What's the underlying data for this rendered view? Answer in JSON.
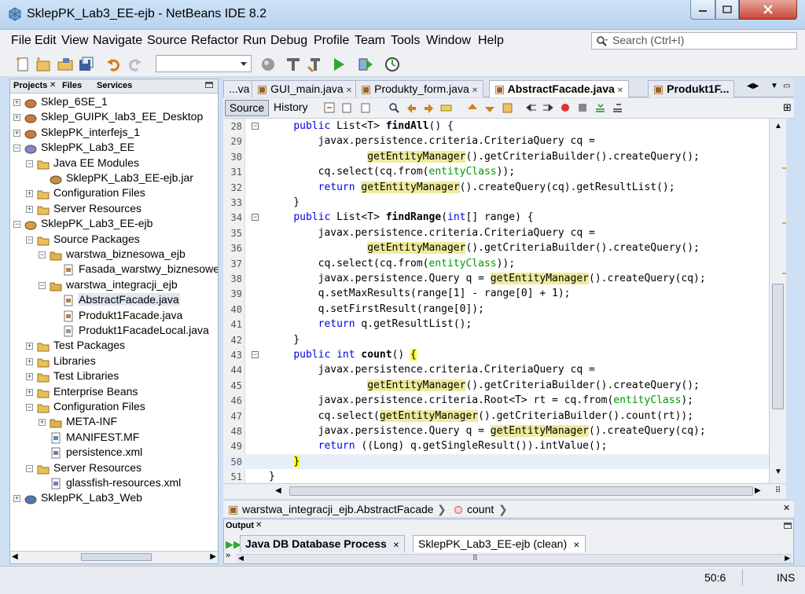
{
  "window": {
    "title": "SklepPK_Lab3_EE-ejb - NetBeans IDE 8.2"
  },
  "menu": [
    "File",
    "Edit",
    "View",
    "Navigate",
    "Source",
    "Refactor",
    "Run",
    "Debug",
    "Profile",
    "Team",
    "Tools",
    "Window",
    "Help"
  ],
  "search": {
    "placeholder": "Search (Ctrl+I)"
  },
  "left_panel": {
    "tabs": [
      "Projects",
      "Files",
      "Services"
    ],
    "tree": [
      {
        "label": "Sklep_6SE_1",
        "icon": "project-icon"
      },
      {
        "label": "Sklep_GUIPK_lab3_EE_Desktop",
        "icon": "project-icon"
      },
      {
        "label": "SklepPK_interfejs_1",
        "icon": "project-icon"
      },
      {
        "label": "SklepPK_Lab3_EE",
        "icon": "enterprise-project-icon"
      },
      {
        "label": "Java EE Modules",
        "icon": "folder-icon"
      },
      {
        "label": "SklepPK_Lab3_EE-ejb.jar",
        "icon": "jar-icon"
      },
      {
        "label": "Configuration Files",
        "icon": "folder-icon"
      },
      {
        "label": "Server Resources",
        "icon": "folder-icon"
      },
      {
        "label": "SklepPK_Lab3_EE-ejb",
        "icon": "ejb-project-icon"
      },
      {
        "label": "Source Packages",
        "icon": "folder-icon"
      },
      {
        "label": "warstwa_biznesowa_ejb",
        "icon": "package-icon"
      },
      {
        "label": "Fasada_warstwy_biznesowej",
        "icon": "java-file-icon"
      },
      {
        "label": "warstwa_integracji_ejb",
        "icon": "package-icon"
      },
      {
        "label": "AbstractFacade.java",
        "icon": "java-file-icon"
      },
      {
        "label": "Produkt1Facade.java",
        "icon": "java-file-icon"
      },
      {
        "label": "Produkt1FacadeLocal.java",
        "icon": "java-interface-icon"
      },
      {
        "label": "Test Packages",
        "icon": "folder-icon"
      },
      {
        "label": "Libraries",
        "icon": "folder-icon"
      },
      {
        "label": "Test Libraries",
        "icon": "folder-icon"
      },
      {
        "label": "Enterprise Beans",
        "icon": "folder-icon"
      },
      {
        "label": "Configuration Files",
        "icon": "folder-icon"
      },
      {
        "label": "META-INF",
        "icon": "package-icon"
      },
      {
        "label": "MANIFEST.MF",
        "icon": "manifest-file-icon"
      },
      {
        "label": "persistence.xml",
        "icon": "xml-file-icon"
      },
      {
        "label": "Server Resources",
        "icon": "folder-icon"
      },
      {
        "label": "glassfish-resources.xml",
        "icon": "xml-file-icon"
      },
      {
        "label": "SklepPK_Lab3_Web",
        "icon": "web-project-icon"
      }
    ]
  },
  "editor": {
    "tabs": [
      {
        "label": "...va"
      },
      {
        "label": "GUI_main.java"
      },
      {
        "label": "Produkty_form.java"
      },
      {
        "label": "AbstractFacade.java"
      },
      {
        "label": "Produkt1F..."
      }
    ],
    "source_label": "Source",
    "history_label": "History",
    "lines": [
      {
        "n": "28",
        "code": "    public List<T> findAll() {"
      },
      {
        "n": "29",
        "code": "        javax.persistence.criteria.CriteriaQuery cq ="
      },
      {
        "n": "30",
        "code": "                getEntityManager().getCriteriaBuilder().createQuery();"
      },
      {
        "n": "31",
        "code": "        cq.select(cq.from(entityClass));"
      },
      {
        "n": "32",
        "code": "        return getEntityManager().createQuery(cq).getResultList();"
      },
      {
        "n": "33",
        "code": "    }"
      },
      {
        "n": "34",
        "code": "    public List<T> findRange(int[] range) {"
      },
      {
        "n": "35",
        "code": "        javax.persistence.criteria.CriteriaQuery cq ="
      },
      {
        "n": "36",
        "code": "                getEntityManager().getCriteriaBuilder().createQuery();"
      },
      {
        "n": "37",
        "code": "        cq.select(cq.from(entityClass));"
      },
      {
        "n": "38",
        "code": "        javax.persistence.Query q = getEntityManager().createQuery(cq);"
      },
      {
        "n": "39",
        "code": "        q.setMaxResults(range[1] - range[0] + 1);"
      },
      {
        "n": "40",
        "code": "        q.setFirstResult(range[0]);"
      },
      {
        "n": "41",
        "code": "        return q.getResultList();"
      },
      {
        "n": "42",
        "code": "    }"
      },
      {
        "n": "43",
        "code": "    public int count() {"
      },
      {
        "n": "44",
        "code": "        javax.persistence.criteria.CriteriaQuery cq ="
      },
      {
        "n": "45",
        "code": "                getEntityManager().getCriteriaBuilder().createQuery();"
      },
      {
        "n": "46",
        "code": "        javax.persistence.criteria.Root<T> rt = cq.from(entityClass);"
      },
      {
        "n": "47",
        "code": "        cq.select(getEntityManager().getCriteriaBuilder().count(rt));"
      },
      {
        "n": "48",
        "code": "        javax.persistence.Query q = getEntityManager().createQuery(cq);"
      },
      {
        "n": "49",
        "code": "        return ((Long) q.getSingleResult()).intValue();"
      },
      {
        "n": "50",
        "code": "    }"
      },
      {
        "n": "51",
        "code": "}"
      }
    ]
  },
  "breadcrumb": {
    "class": "warstwa_integracji_ejb.AbstractFacade",
    "member": "count"
  },
  "output": {
    "title": "Output",
    "tabs": [
      {
        "label": "Java DB Database Process"
      },
      {
        "label": "SklepPK_Lab3_EE-ejb (clean)"
      }
    ]
  },
  "status": {
    "position": "50:6",
    "mode": "INS"
  }
}
